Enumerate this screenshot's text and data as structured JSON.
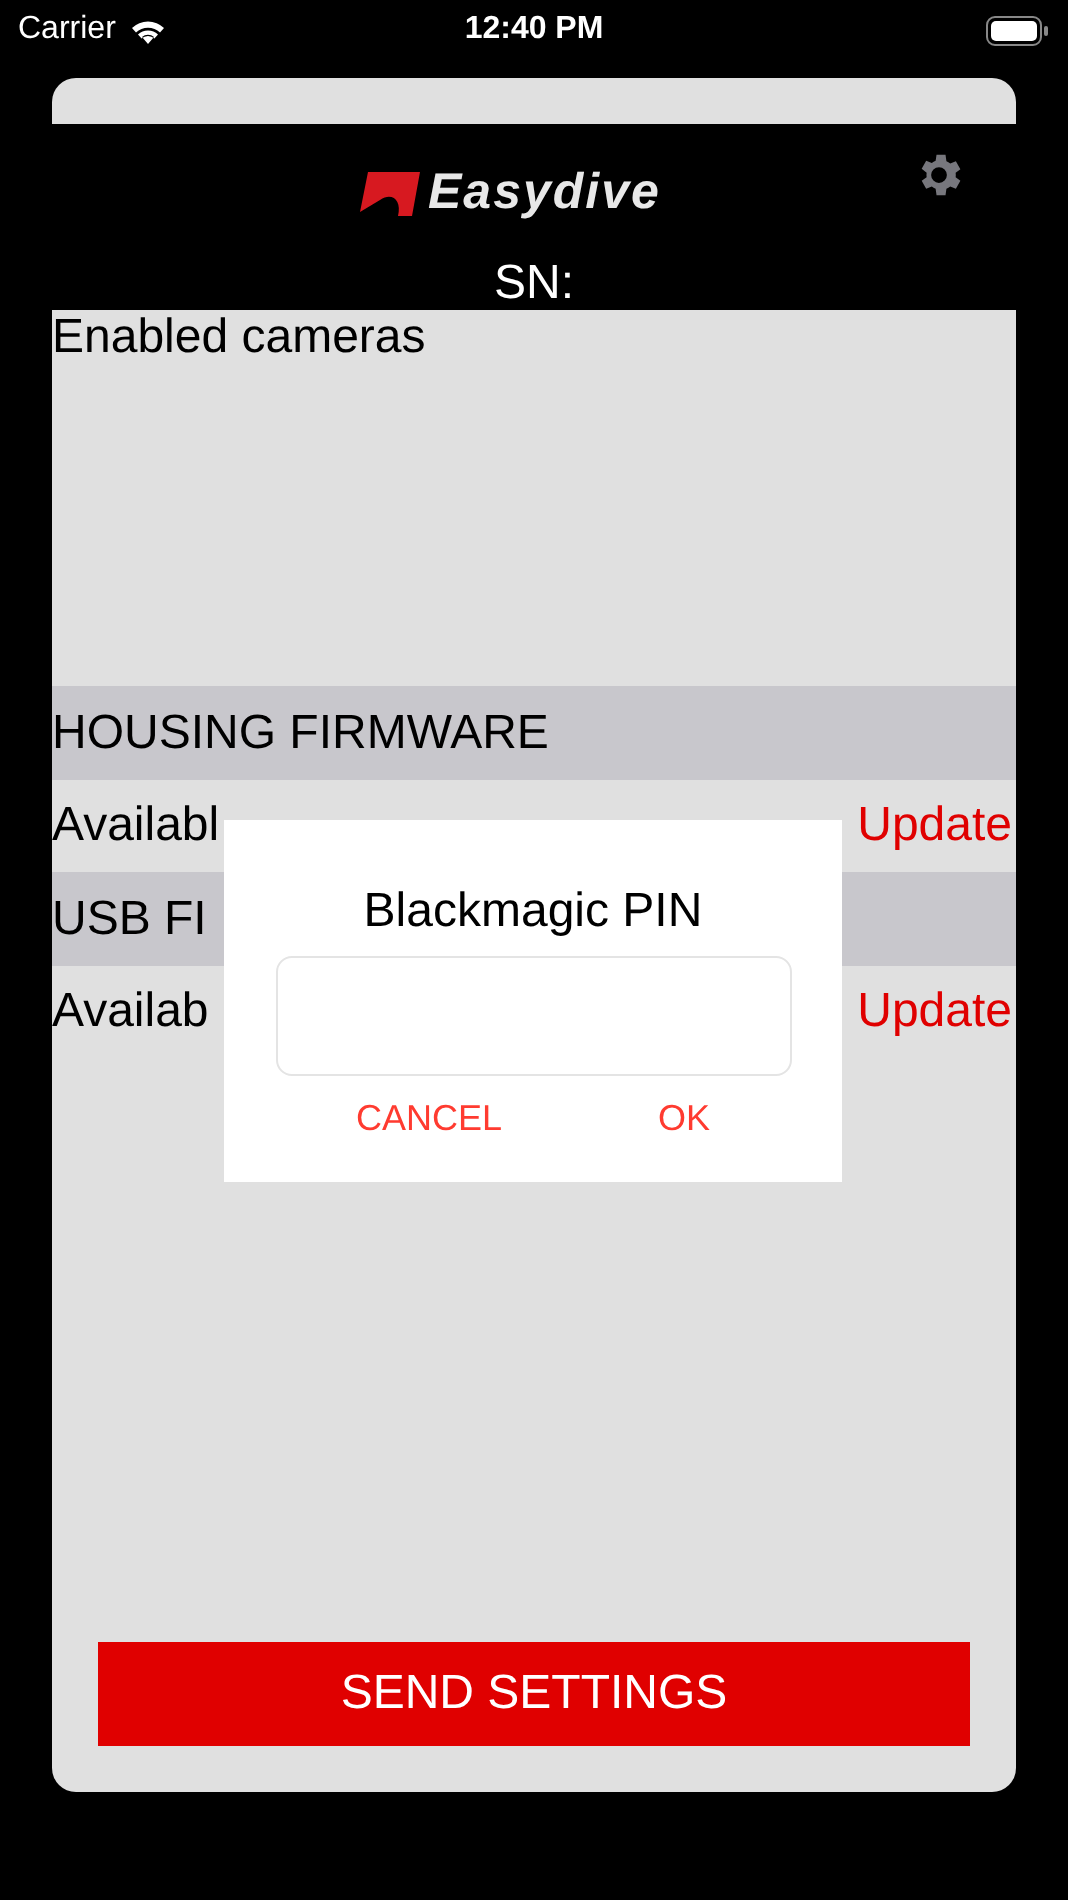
{
  "status_bar": {
    "carrier": "Carrier",
    "time": "12:40 PM"
  },
  "header": {
    "logo": "Easydive",
    "sn_label": "SN:"
  },
  "cameras": {
    "title": "Enabled cameras"
  },
  "sections": [
    {
      "title": "HOUSING FIRMWARE",
      "row": {
        "label": "Availabl",
        "action": "Update"
      }
    },
    {
      "title": "USB FI",
      "row": {
        "label": "Availab",
        "action": "Update"
      }
    }
  ],
  "send_button": "SEND SETTINGS",
  "dialog": {
    "title": "Blackmagic PIN",
    "buttons": [
      "CANCEL",
      "OK"
    ]
  }
}
